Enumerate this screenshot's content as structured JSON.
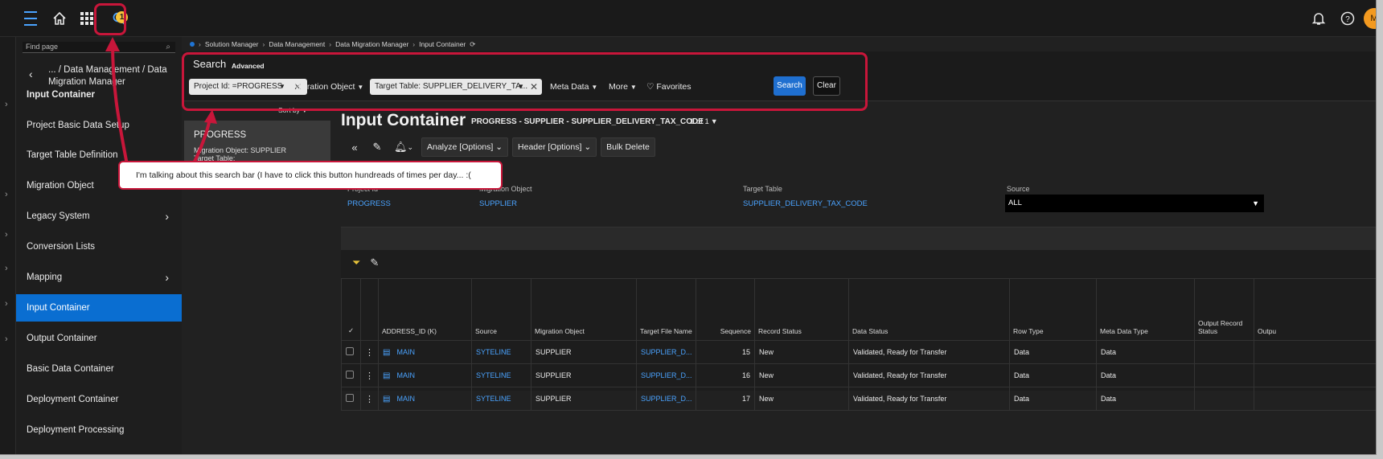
{
  "topbar": {
    "notification_badge": "1",
    "avatar_initial": "M"
  },
  "nav": {
    "find_placeholder": "Find page",
    "crumb": "... / Data Management / Data Migration Manager",
    "items": [
      {
        "label": "Input Container",
        "bold": true
      },
      {
        "label": "Project Basic Data Setup"
      },
      {
        "label": "Target Table Definition"
      },
      {
        "label": "Migration Object"
      },
      {
        "label": "Legacy System",
        "chevron": true
      },
      {
        "label": "Conversion Lists"
      },
      {
        "label": "Mapping",
        "chevron": true
      },
      {
        "label": "Input Container",
        "active": true
      },
      {
        "label": "Output Container"
      },
      {
        "label": "Basic Data Container"
      },
      {
        "label": "Deployment Container"
      },
      {
        "label": "Deployment Processing"
      }
    ]
  },
  "breadcrumbs": [
    "Solution Manager",
    "Data Management",
    "Data Migration Manager",
    "Input Container"
  ],
  "search": {
    "title": "Search",
    "advanced": "Advanced",
    "chip_project": "Project Id: =PROGRESS",
    "migration_object": "Migration Object",
    "chip_target": "Target Table: SUPPLIER_DELIVERY_TA...",
    "meta_data": "Meta Data",
    "more": "More",
    "favorites": "Favorites",
    "search_btn": "Search",
    "clear_btn": "Clear"
  },
  "list": {
    "sort_by": "Sort by",
    "card_title": "PROGRESS",
    "card_line1": "Migration Object:  SUPPLIER",
    "card_line2": "Target Table:"
  },
  "header": {
    "title": "Input Container",
    "subtitle": "PROGRESS - SUPPLIER - SUPPLIER_DELIVERY_TAX_CODE",
    "count": "1 of 1",
    "analyze": "Analyze [Options]",
    "header_opts": "Header [Options]",
    "bulk_delete": "Bulk Delete"
  },
  "fields": {
    "project_id_label": "Project Id",
    "project_id_value": "PROGRESS",
    "migration_object_label": "Migration Object",
    "migration_object_value": "SUPPLIER",
    "target_table_label": "Target Table",
    "target_table_value": "SUPPLIER_DELIVERY_TAX_CODE",
    "source_label": "Source",
    "source_value": "ALL"
  },
  "table": {
    "columns": [
      "ADDRESS_ID (K)",
      "Source",
      "Migration Object",
      "Target File Name",
      "Sequence",
      "Record Status",
      "Data Status",
      "Row Type",
      "Meta Data Type",
      "Output Record Status",
      "Outpu"
    ],
    "rows": [
      [
        "MAIN",
        "SYTELINE",
        "SUPPLIER",
        "SUPPLIER_D...",
        "15",
        "New",
        "Validated, Ready for Transfer",
        "Data",
        "Data",
        "",
        ""
      ],
      [
        "MAIN",
        "SYTELINE",
        "SUPPLIER",
        "SUPPLIER_D...",
        "16",
        "New",
        "Validated, Ready for Transfer",
        "Data",
        "Data",
        "",
        ""
      ],
      [
        "MAIN",
        "SYTELINE",
        "SUPPLIER",
        "SUPPLIER_D...",
        "17",
        "New",
        "Validated, Ready for Transfer",
        "Data",
        "Data",
        "",
        ""
      ]
    ]
  },
  "annotation": {
    "callout": "I'm talking about this search bar (I have to click this button hundreads of times per day... :("
  },
  "colors": {
    "accent": "#0a6ed1",
    "annotation": "#c8163a",
    "link": "#4aa3ff"
  }
}
